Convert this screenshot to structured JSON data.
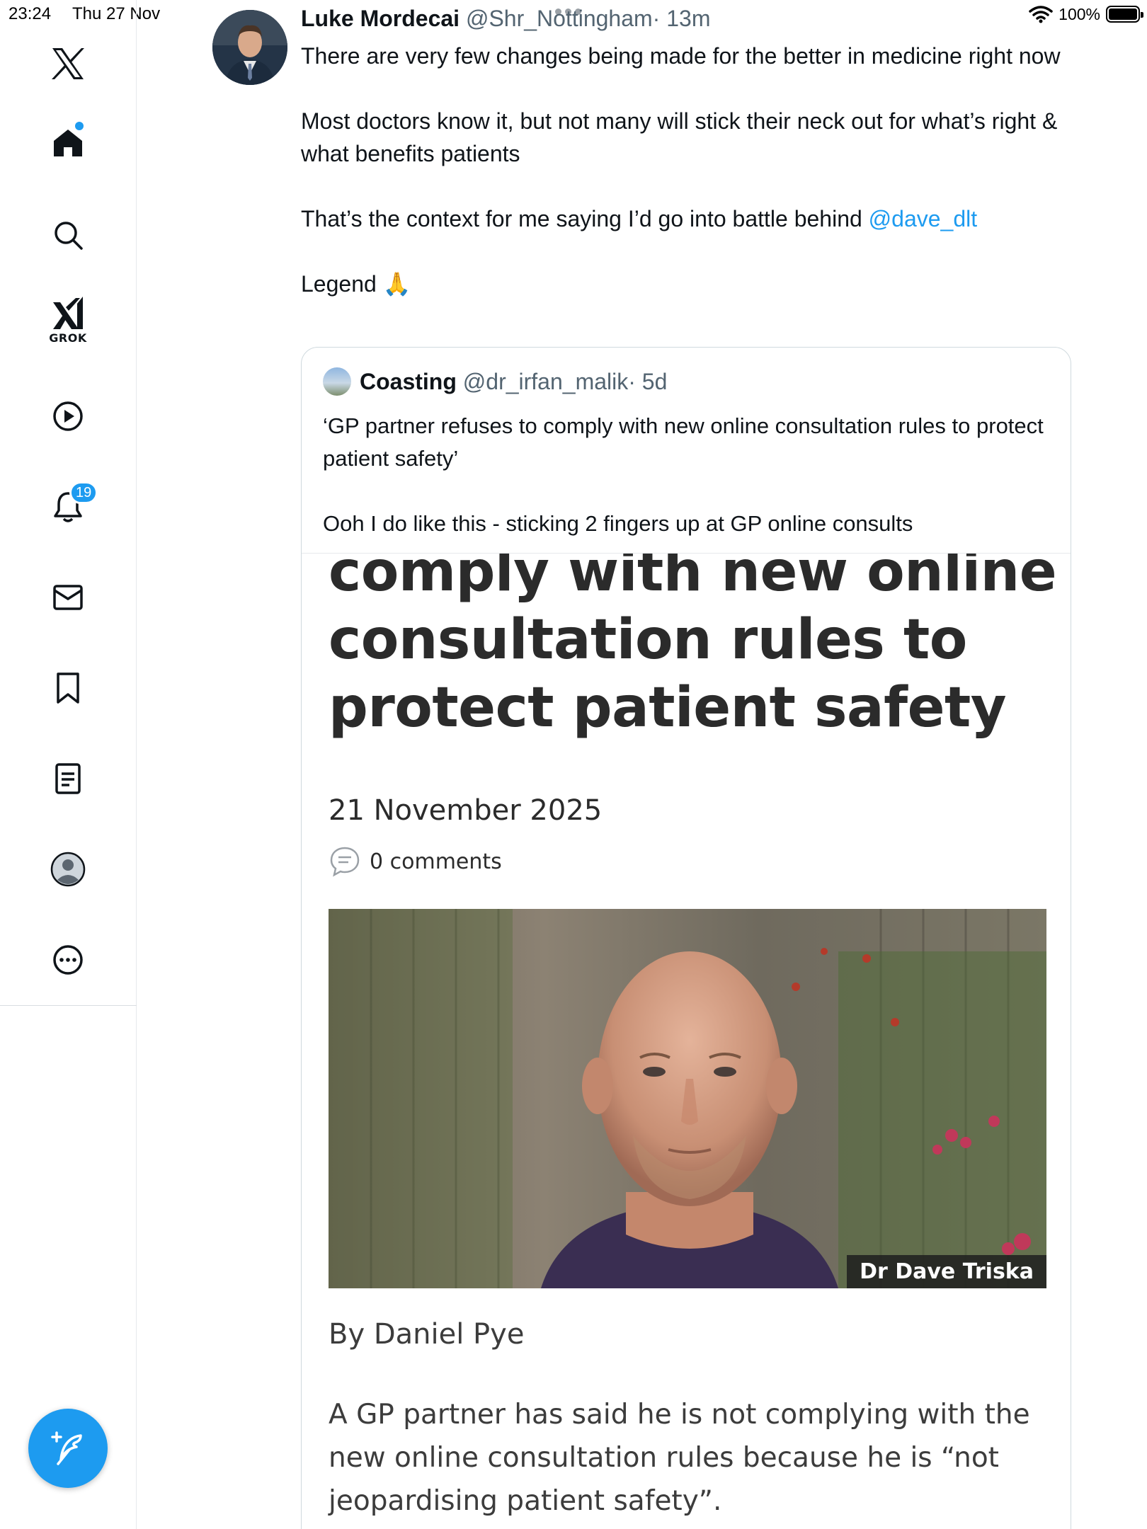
{
  "status_bar": {
    "time": "23:24",
    "date": "Thu 27 Nov",
    "battery_text": "100%",
    "battery_level": 1.0
  },
  "sidebar": {
    "items": [
      {
        "name": "x-logo",
        "icon": "x-logo-icon"
      },
      {
        "name": "home",
        "icon": "home-icon",
        "active": true,
        "has_dot": true
      },
      {
        "name": "search",
        "icon": "search-icon"
      },
      {
        "name": "grok",
        "icon": "grok-icon",
        "label": "GROK"
      },
      {
        "name": "video",
        "icon": "play-icon"
      },
      {
        "name": "notifications",
        "icon": "bell-icon",
        "badge": "19"
      },
      {
        "name": "messages",
        "icon": "mail-icon"
      },
      {
        "name": "bookmarks",
        "icon": "bookmark-icon"
      },
      {
        "name": "articles",
        "icon": "article-icon"
      },
      {
        "name": "profile",
        "icon": "profile-icon"
      },
      {
        "name": "more",
        "icon": "more-icon"
      }
    ],
    "compose_icon": "compose-icon"
  },
  "tweet": {
    "author": "Luke Mordecai",
    "handle": "@Shr_Nottingham",
    "time": "· 13m",
    "lines": {
      "p1": "There are very few changes being made for the better in medicine right now",
      "p2": "Most doctors know it, but not many will stick their neck out for what’s right & what benefits patients",
      "p3_pre": "That’s the context for me saying I’d go into battle behind ",
      "p3_mention": "@dave_dlt",
      "p4": "Legend 🙏"
    }
  },
  "quote": {
    "author": "Coasting",
    "handle": "@dr_irfan_malik",
    "time": "· 5d",
    "p1": "‘GP partner refuses to comply with new online consultation rules to protect patient safety’",
    "p2": "Ooh I do like this - sticking 2 fingers up at GP online consults"
  },
  "article": {
    "headline": "GP partner refuses to comply with new online consultation rules to protect patient safety",
    "date": "21 November 2025",
    "comments": "0 comments",
    "photo_caption": "Dr Dave Triska",
    "byline": "By Daniel Pye",
    "body": "A GP partner has said he is not complying with the new online consultation rules because he is “not jeopardising patient safety”."
  },
  "colors": {
    "accent": "#1d9bf0",
    "text": "#0f1419",
    "muted": "#536471",
    "article_text": "#2b2b2b"
  }
}
